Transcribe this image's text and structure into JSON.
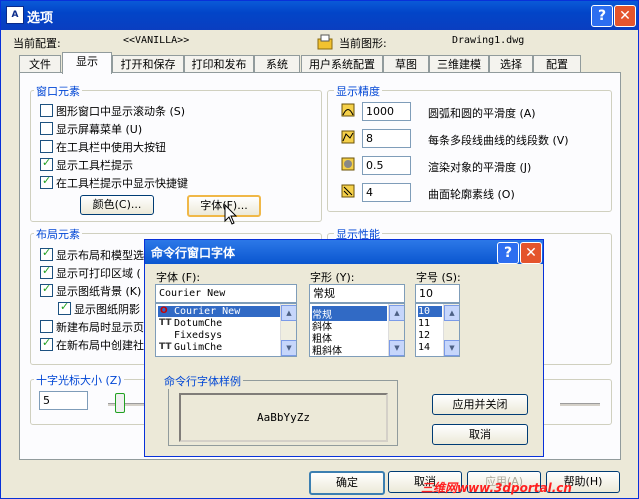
{
  "window": {
    "title": "选项",
    "help": "?",
    "close": "✕",
    "app_icon": "A"
  },
  "profile": {
    "current_config_label": "当前配置:",
    "current_config_value": "<<VANILLA>>",
    "current_drawing_label": "当前图形:",
    "current_drawing_value": "Drawing1.dwg"
  },
  "tabs": [
    {
      "label": "文件"
    },
    {
      "label": "显示"
    },
    {
      "label": "打开和保存"
    },
    {
      "label": "打印和发布"
    },
    {
      "label": "系统"
    },
    {
      "label": "用户系统配置"
    },
    {
      "label": "草图"
    },
    {
      "label": "三维建模"
    },
    {
      "label": "选择"
    },
    {
      "label": "配置"
    }
  ],
  "window_elements": {
    "title": "窗口元素",
    "items": [
      {
        "label": "图形窗口中显示滚动条 (S)",
        "checked": false
      },
      {
        "label": "显示屏幕菜单 (U)",
        "checked": false
      },
      {
        "label": "在工具栏中使用大按钮",
        "checked": false
      },
      {
        "label": "显示工具栏提示",
        "checked": true
      },
      {
        "label": "在工具栏提示中显示快捷键",
        "checked": true
      }
    ],
    "colors_button": "颜色(C)...",
    "fonts_button": "字体(F)..."
  },
  "display_resolution": {
    "title": "显示精度",
    "items": [
      {
        "value": "1000",
        "label": "圆弧和圆的平滑度 (A)"
      },
      {
        "value": "8",
        "label": "每条多段线曲线的线段数 (V)"
      },
      {
        "value": "0.5",
        "label": "渲染对象的平滑度 (J)"
      },
      {
        "value": "4",
        "label": "曲面轮廓素线 (O)"
      }
    ]
  },
  "layout_elements": {
    "title": "布局元素",
    "items": [
      {
        "label": "显示布局和模型选",
        "checked": true
      },
      {
        "label": "显示可打印区域 (",
        "checked": true
      },
      {
        "label": "显示图纸背景 (K)",
        "checked": true
      },
      {
        "label": "显示图纸阴影",
        "checked": true
      },
      {
        "label": "新建布局时显示页",
        "checked": false
      },
      {
        "label": "在新布局中创建社",
        "checked": true
      }
    ]
  },
  "display_performance": {
    "title": "显示性能"
  },
  "crosshair": {
    "label": "十字光标大小 (Z)",
    "value": "5"
  },
  "bottom_buttons": {
    "ok": "确定",
    "cancel": "取消",
    "apply": "应用(A)",
    "help": "帮助(H)"
  },
  "watermark": "三维网www.3dportal.cn",
  "font_dialog": {
    "title": "命令行窗口字体",
    "help": "?",
    "close": "✕",
    "font_label": "字体 (F):",
    "font_value": "Courier New",
    "fonts": [
      "Courier New",
      "DotumChe",
      "Fixedsys",
      "GulimChe"
    ],
    "style_label": "字形 (Y):",
    "style_value": "常规",
    "styles": [
      "常规",
      "斜体",
      "粗体",
      "粗斜体"
    ],
    "size_label": "字号 (S):",
    "size_value": "10",
    "sizes": [
      "10",
      "11",
      "12",
      "14"
    ],
    "sample_title": "命令行字体样例",
    "sample_text": "AaBbYyZz",
    "apply_close_button": "应用并关闭",
    "cancel_button": "取消"
  }
}
